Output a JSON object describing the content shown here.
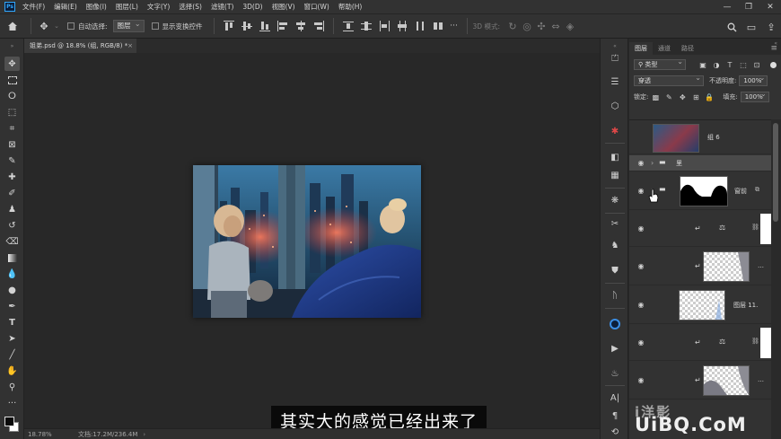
{
  "app": {
    "logo": "Ps"
  },
  "menu": [
    "文件(F)",
    "编辑(E)",
    "图像(I)",
    "图层(L)",
    "文字(Y)",
    "选择(S)",
    "滤镜(T)",
    "3D(D)",
    "视图(V)",
    "窗口(W)",
    "帮助(H)"
  ],
  "window_controls": {
    "minimize": "—",
    "restore": "❐",
    "close": "✕"
  },
  "options": {
    "auto_select_label": "自动选择:",
    "auto_select_value": "图层",
    "show_transform_label": "显示变换控件",
    "mode_3d_label": "3D 模式:"
  },
  "document": {
    "tab_title": "姐弟.psd @ 18.8% (组, RGB/8) *",
    "close": "×"
  },
  "status": {
    "zoom": "18.78%",
    "doc_info": "文档:17.2M/236.4M",
    "arrow": "›"
  },
  "subtitle": "其实大的感觉已经出来了",
  "layers_panel": {
    "tabs": [
      "图层",
      "通道",
      "路径"
    ],
    "menu_icon": "≡",
    "kind_filter": "类型",
    "blend_mode": "穿透",
    "opacity_label": "不透明度:",
    "opacity_value": "100%",
    "lock_label": "锁定:",
    "fill_label": "填充:",
    "fill_value": "100%",
    "layers": [
      {
        "name": "组 6",
        "type": "smart"
      },
      {
        "name": "里",
        "type": "group"
      },
      {
        "name": "窗前",
        "type": "group-mask"
      },
      {
        "name": "",
        "type": "levels"
      },
      {
        "name": "…",
        "type": "clipped"
      },
      {
        "name": "图层 11.",
        "type": "pixel"
      },
      {
        "name": "",
        "type": "levels"
      },
      {
        "name": "…",
        "type": "clipped"
      }
    ]
  },
  "watermark": {
    "top": "i洋影",
    "main": "UiBQ.CoM"
  },
  "colors": {
    "accent": "#31a8ff",
    "panel_bg": "#323232",
    "canvas_bg": "#282828"
  }
}
